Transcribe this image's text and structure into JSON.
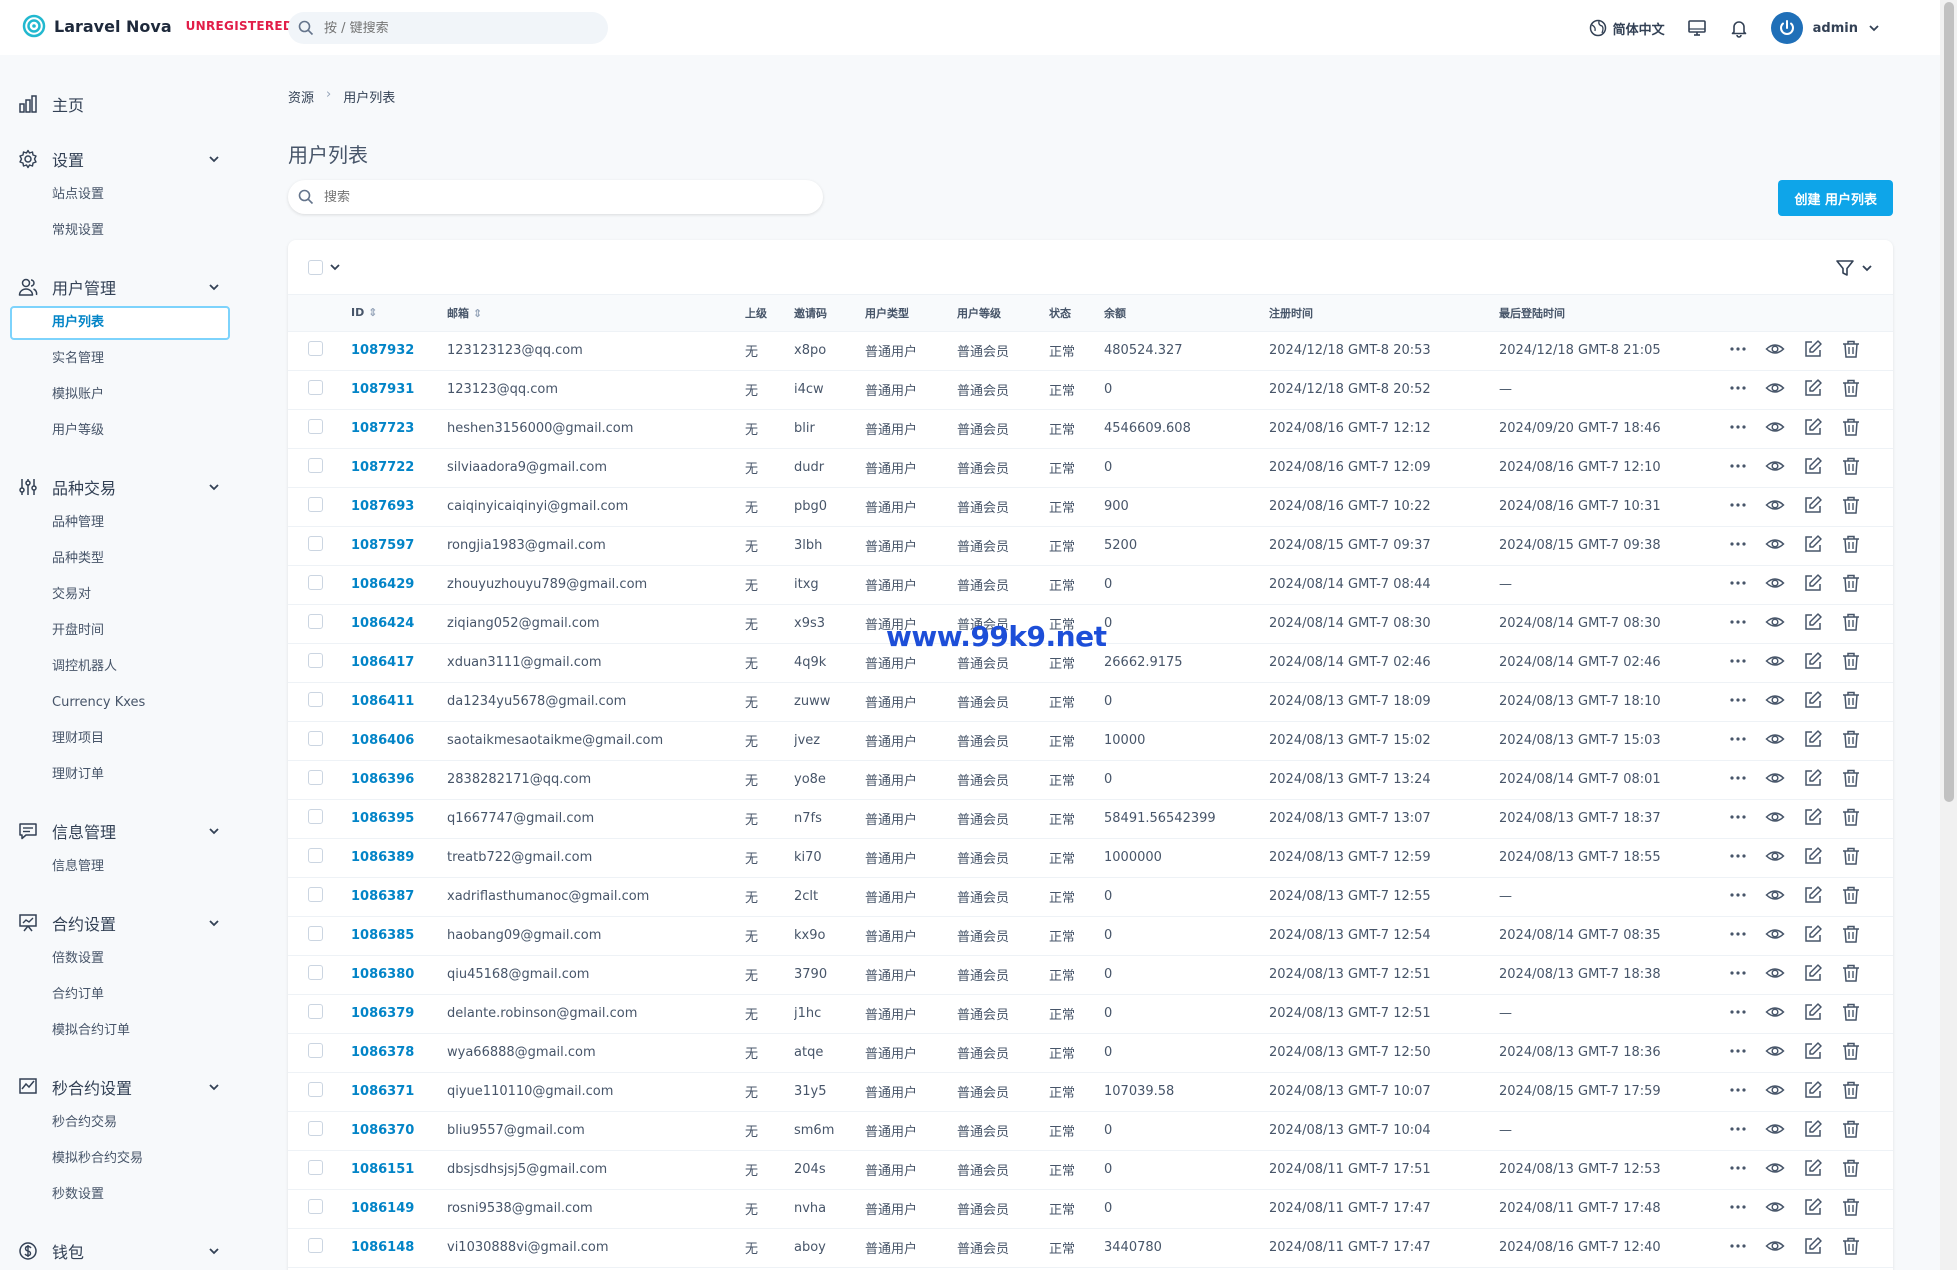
{
  "app": {
    "name": "Laravel Nova",
    "tag": "UNREGISTERED"
  },
  "topbar": {
    "search_placeholder": "按 / 键搜索",
    "language": "简体中文",
    "user": "admin"
  },
  "sidebar": {
    "sections": [
      {
        "label": "主页",
        "icon": "chart-bar-icon",
        "items": []
      },
      {
        "label": "设置",
        "icon": "gear-icon",
        "items": [
          "站点设置",
          "常规设置"
        ]
      },
      {
        "label": "用户管理",
        "icon": "users-icon",
        "items": [
          "用户列表",
          "实名管理",
          "模拟账户",
          "用户等级"
        ]
      },
      {
        "label": "品种交易",
        "icon": "sliders-icon",
        "items": [
          "品种管理",
          "品种类型",
          "交易对",
          "开盘时间",
          "调控机器人",
          "Currency Kxes",
          "理财项目",
          "理财订单"
        ]
      },
      {
        "label": "信息管理",
        "icon": "chat-icon",
        "items": [
          "信息管理"
        ]
      },
      {
        "label": "合约设置",
        "icon": "presentation-chart-icon",
        "items": [
          "倍数设置",
          "合约订单",
          "模拟合约订单"
        ]
      },
      {
        "label": "秒合约设置",
        "icon": "trend-chart-icon",
        "items": [
          "秒合约交易",
          "模拟秒合约交易",
          "秒数设置"
        ]
      },
      {
        "label": "钱包",
        "icon": "currency-icon",
        "items": []
      }
    ],
    "active_item": "用户列表"
  },
  "breadcrumb": [
    "资源",
    "用户列表"
  ],
  "page": {
    "title": "用户列表",
    "search_placeholder": "搜索",
    "create_button": "创建 用户列表"
  },
  "watermark": "www.99k9.net",
  "table": {
    "columns": [
      "ID",
      "邮箱",
      "上级",
      "邀请码",
      "用户类型",
      "用户等级",
      "状态",
      "余额",
      "注册时间",
      "最后登陆时间"
    ],
    "rows": [
      [
        "1087932",
        "123123123@qq.com",
        "无",
        "x8po",
        "普通用户",
        "普通会员",
        "正常",
        "480524.327",
        "2024/12/18 GMT-8 20:53",
        "2024/12/18 GMT-8 21:05"
      ],
      [
        "1087931",
        "123123@qq.com",
        "无",
        "i4cw",
        "普通用户",
        "普通会员",
        "正常",
        "0",
        "2024/12/18 GMT-8 20:52",
        "—"
      ],
      [
        "1087723",
        "heshen3156000@gmail.com",
        "无",
        "blir",
        "普通用户",
        "普通会员",
        "正常",
        "4546609.608",
        "2024/08/16 GMT-7 12:12",
        "2024/09/20 GMT-7 18:46"
      ],
      [
        "1087722",
        "silviaadora9@gmail.com",
        "无",
        "dudr",
        "普通用户",
        "普通会员",
        "正常",
        "0",
        "2024/08/16 GMT-7 12:09",
        "2024/08/16 GMT-7 12:10"
      ],
      [
        "1087693",
        "caiqinyicaiqinyi@gmail.com",
        "无",
        "pbg0",
        "普通用户",
        "普通会员",
        "正常",
        "900",
        "2024/08/16 GMT-7 10:22",
        "2024/08/16 GMT-7 10:31"
      ],
      [
        "1087597",
        "rongjia1983@gmail.com",
        "无",
        "3lbh",
        "普通用户",
        "普通会员",
        "正常",
        "5200",
        "2024/08/15 GMT-7 09:37",
        "2024/08/15 GMT-7 09:38"
      ],
      [
        "1086429",
        "zhouyuzhouyu789@gmail.com",
        "无",
        "itxg",
        "普通用户",
        "普通会员",
        "正常",
        "0",
        "2024/08/14 GMT-7 08:44",
        "—"
      ],
      [
        "1086424",
        "ziqiang052@gmail.com",
        "无",
        "x9s3",
        "普通用户",
        "普通会员",
        "正常",
        "0",
        "2024/08/14 GMT-7 08:30",
        "2024/08/14 GMT-7 08:30"
      ],
      [
        "1086417",
        "xduan3111@gmail.com",
        "无",
        "4q9k",
        "普通用户",
        "普通会员",
        "正常",
        "26662.9175",
        "2024/08/14 GMT-7 02:46",
        "2024/08/14 GMT-7 02:46"
      ],
      [
        "1086411",
        "da1234yu5678@gmail.com",
        "无",
        "zuww",
        "普通用户",
        "普通会员",
        "正常",
        "0",
        "2024/08/13 GMT-7 18:09",
        "2024/08/13 GMT-7 18:10"
      ],
      [
        "1086406",
        "saotaikmesaotaikme@gmail.com",
        "无",
        "jvez",
        "普通用户",
        "普通会员",
        "正常",
        "10000",
        "2024/08/13 GMT-7 15:02",
        "2024/08/13 GMT-7 15:03"
      ],
      [
        "1086396",
        "2838282171@qq.com",
        "无",
        "yo8e",
        "普通用户",
        "普通会员",
        "正常",
        "0",
        "2024/08/13 GMT-7 13:24",
        "2024/08/14 GMT-7 08:01"
      ],
      [
        "1086395",
        "q1667747@gmail.com",
        "无",
        "n7fs",
        "普通用户",
        "普通会员",
        "正常",
        "58491.56542399",
        "2024/08/13 GMT-7 13:07",
        "2024/08/13 GMT-7 18:37"
      ],
      [
        "1086389",
        "treatb722@gmail.com",
        "无",
        "ki70",
        "普通用户",
        "普通会员",
        "正常",
        "1000000",
        "2024/08/13 GMT-7 12:59",
        "2024/08/13 GMT-7 18:55"
      ],
      [
        "1086387",
        "xadriflasthumanoc@gmail.com",
        "无",
        "2clt",
        "普通用户",
        "普通会员",
        "正常",
        "0",
        "2024/08/13 GMT-7 12:55",
        "—"
      ],
      [
        "1086385",
        "haobang09@gmail.com",
        "无",
        "kx9o",
        "普通用户",
        "普通会员",
        "正常",
        "0",
        "2024/08/13 GMT-7 12:54",
        "2024/08/14 GMT-7 08:35"
      ],
      [
        "1086380",
        "qiu45168@gmail.com",
        "无",
        "3790",
        "普通用户",
        "普通会员",
        "正常",
        "0",
        "2024/08/13 GMT-7 12:51",
        "2024/08/13 GMT-7 18:38"
      ],
      [
        "1086379",
        "delante.robinson@gmail.com",
        "无",
        "j1hc",
        "普通用户",
        "普通会员",
        "正常",
        "0",
        "2024/08/13 GMT-7 12:51",
        "—"
      ],
      [
        "1086378",
        "wya66888@gmail.com",
        "无",
        "atqe",
        "普通用户",
        "普通会员",
        "正常",
        "0",
        "2024/08/13 GMT-7 12:50",
        "2024/08/13 GMT-7 18:36"
      ],
      [
        "1086371",
        "qiyue110110@gmail.com",
        "无",
        "31y5",
        "普通用户",
        "普通会员",
        "正常",
        "107039.58",
        "2024/08/13 GMT-7 10:07",
        "2024/08/15 GMT-7 17:59"
      ],
      [
        "1086370",
        "bliu9557@gmail.com",
        "无",
        "sm6m",
        "普通用户",
        "普通会员",
        "正常",
        "0",
        "2024/08/13 GMT-7 10:04",
        "—"
      ],
      [
        "1086151",
        "dbsjsdhsjsj5@gmail.com",
        "无",
        "204s",
        "普通用户",
        "普通会员",
        "正常",
        "0",
        "2024/08/11 GMT-7 17:51",
        "2024/08/13 GMT-7 12:53"
      ],
      [
        "1086149",
        "rosni9538@gmail.com",
        "无",
        "nvha",
        "普通用户",
        "普通会员",
        "正常",
        "0",
        "2024/08/11 GMT-7 17:47",
        "2024/08/11 GMT-7 17:48"
      ],
      [
        "1086148",
        "vi1030888vi@gmail.com",
        "无",
        "aboy",
        "普通用户",
        "普通会员",
        "正常",
        "3440780",
        "2024/08/11 GMT-7 17:47",
        "2024/08/16 GMT-7 12:40"
      ]
    ]
  }
}
